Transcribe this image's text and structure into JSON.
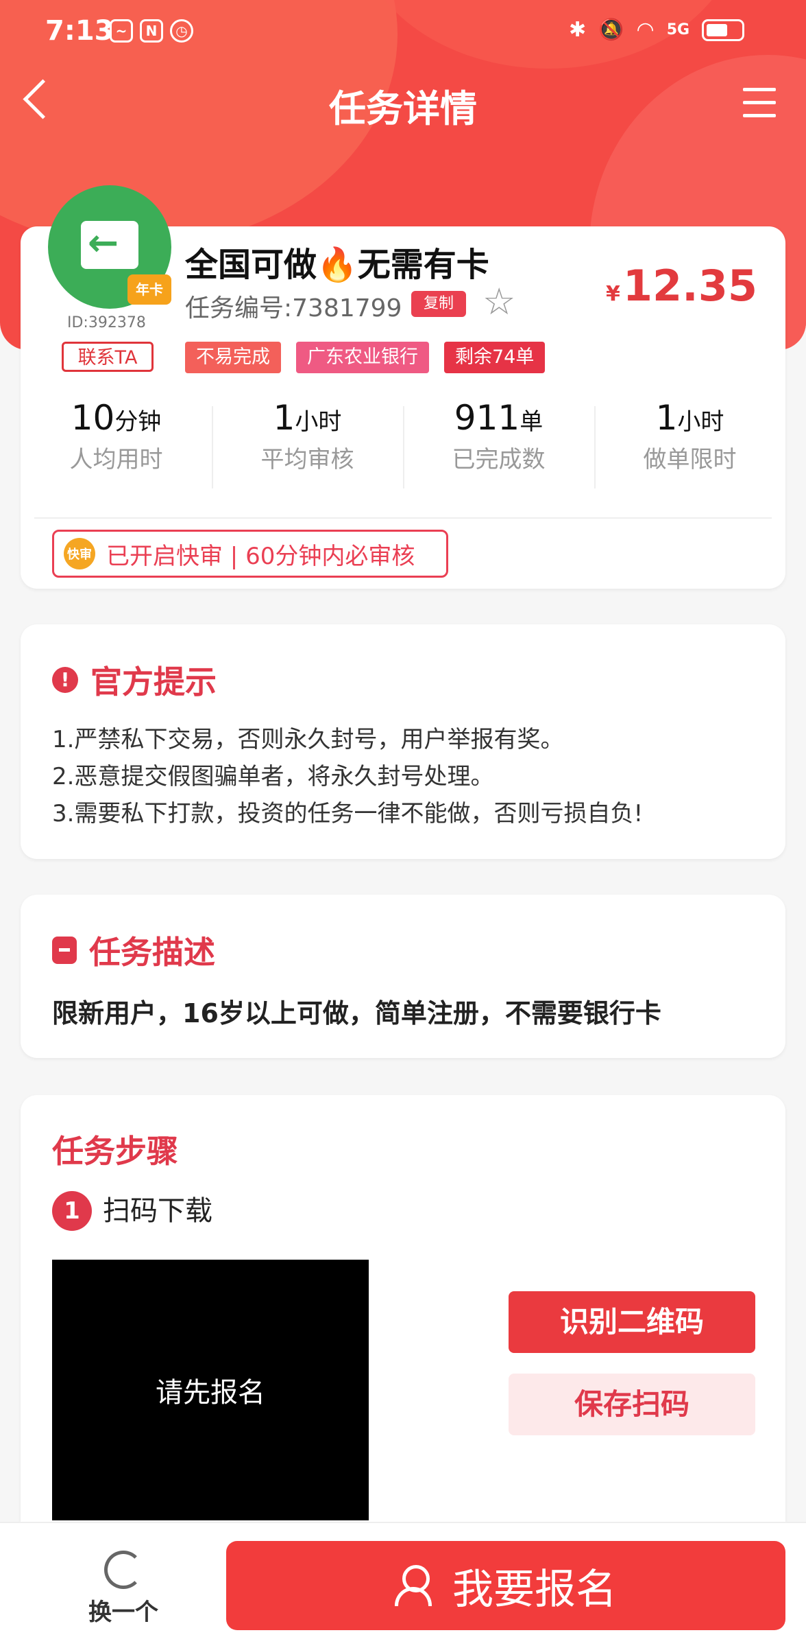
{
  "status_bar": {
    "time": "7:13",
    "network": "5G"
  },
  "nav": {
    "title": "任务详情"
  },
  "task": {
    "user_id": "ID:392378",
    "contact_label": "联系TA",
    "crown_label": "年卡",
    "title": "全国可做🔥无需有卡",
    "task_no": "任务编号:7381799",
    "copy_label": "复制",
    "price_currency": "¥",
    "price": "12.35",
    "tags": [
      {
        "label": "不易完成",
        "color": "#f3605a"
      },
      {
        "label": "广东农业银行",
        "color": "#ef5a83"
      },
      {
        "label": "剩余74单",
        "color": "#e63346"
      }
    ],
    "stats": [
      {
        "num": "10",
        "unit": "分钟",
        "label": "人均用时"
      },
      {
        "num": "1",
        "unit": "小时",
        "label": "平均审核"
      },
      {
        "num": "911",
        "unit": "单",
        "label": "已完成数"
      },
      {
        "num": "1",
        "unit": "小时",
        "label": "做单限时"
      }
    ],
    "fast_badge": "快审",
    "fast_text": "已开启快审 | 60分钟内必审核"
  },
  "notice": {
    "title": "官方提示",
    "lines": [
      "1.严禁私下交易，否则永久封号，用户举报有奖。",
      "2.恶意提交假图骗单者，将永久封号处理。",
      "3.需要私下打款，投资的任务一律不能做，否则亏损自负!"
    ]
  },
  "description": {
    "title": "任务描述",
    "text": "限新用户，16岁以上可做，简单注册，不需要银行卡"
  },
  "steps": {
    "title": "任务步骤",
    "step1_num": "1",
    "step1_label": "扫码下载",
    "qr_placeholder": "请先报名",
    "identify_button": "识别二维码",
    "save_button": "保存扫码"
  },
  "bottom": {
    "swap_label": "换一个",
    "signup_label": "我要报名"
  }
}
